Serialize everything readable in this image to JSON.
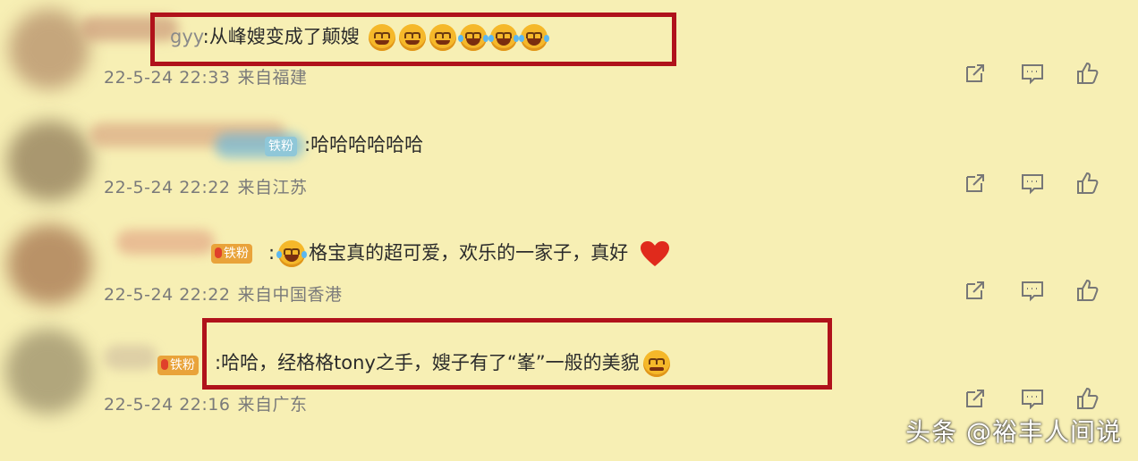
{
  "comments": [
    {
      "user_prefix": "gyy",
      "text": ":从峰嫂变成了颠嫂",
      "date": "22-5-24 22:33",
      "location": "来自福建"
    },
    {
      "badge": "铁粉",
      "text": ":哈哈哈哈哈哈",
      "date": "22-5-24 22:22",
      "location": "来自江苏"
    },
    {
      "badge": "铁粉",
      "text": "格宝真的超可爱，欢乐的一家子，真好",
      "date": "22-5-24 22:22",
      "location": "来自中国香港"
    },
    {
      "badge": "铁粉",
      "text": ":哈哈，经格格tony之手，嫂子有了“峯”一般的美貌",
      "date": "22-5-24 22:16",
      "location": "来自广东"
    }
  ],
  "actions": {
    "share_icon": "share-icon",
    "comment_icon": "comment-icon",
    "like_icon": "like-icon"
  },
  "watermark": "头条 @裕丰人间说",
  "colors": {
    "background": "#f7efb4",
    "highlight": "#b0121b",
    "meta": "#7a7a7a"
  }
}
